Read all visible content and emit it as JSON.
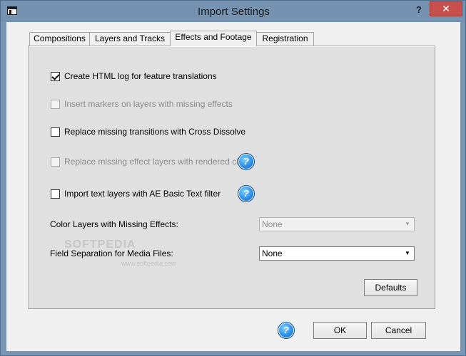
{
  "window": {
    "title": "Import Settings",
    "help_glyph": "?",
    "close_glyph": "✕"
  },
  "tabs": [
    {
      "label": "Compositions"
    },
    {
      "label": "Layers and Tracks"
    },
    {
      "label": "Effects and Footage",
      "active": true
    },
    {
      "label": "Registration"
    }
  ],
  "options": {
    "html_log": {
      "label": "Create HTML log for feature translations",
      "checked": true,
      "enabled": true
    },
    "insert_markers": {
      "label": "Insert markers on layers with missing effects",
      "checked": false,
      "enabled": false
    },
    "replace_transitions": {
      "label": "Replace missing transitions with Cross Dissolve",
      "checked": false,
      "enabled": true
    },
    "replace_effect_layers": {
      "label": "Replace missing effect layers with rendered clips",
      "checked": false,
      "enabled": false
    },
    "import_text_layers": {
      "label": "Import text layers with AE Basic Text filter",
      "checked": false,
      "enabled": true
    }
  },
  "fields": {
    "color_layers": {
      "label": "Color Layers with Missing Effects:",
      "value": "None",
      "enabled": false
    },
    "field_separation": {
      "label": "Field Separation for Media Files:",
      "value": "None",
      "enabled": true
    }
  },
  "buttons": {
    "defaults": "Defaults",
    "ok": "OK",
    "cancel": "Cancel"
  },
  "help_glyph": "?",
  "dropdown_glyph": "▼",
  "watermark": {
    "text": "SOFTPEDIA",
    "url": "www.softpedia.com"
  }
}
